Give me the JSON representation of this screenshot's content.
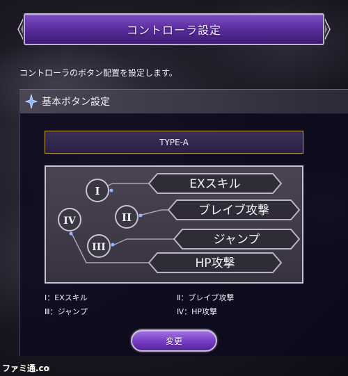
{
  "header": {
    "title": "コントローラ設定"
  },
  "description": "コントローラのボタン配置を設定します。",
  "section": {
    "title": "基本ボタン設定"
  },
  "layout_type": "TYPE-A",
  "diagram": {
    "buttons": [
      {
        "numeral": "I",
        "action": "EXスキル"
      },
      {
        "numeral": "II",
        "action": "ブレイブ攻撃"
      },
      {
        "numeral": "III",
        "action": "ジャンプ"
      },
      {
        "numeral": "IV",
        "action": "HP攻撃"
      }
    ]
  },
  "legend": {
    "i": "Ⅰ：EXスキル",
    "ii": "Ⅱ：ブレイブ攻撃",
    "iii": "Ⅲ：ジャンプ",
    "iv": "Ⅳ：HP攻撃"
  },
  "change_button": "変更",
  "watermark": "ファミ通.com",
  "colors": {
    "accent_purple": "#6a35b5",
    "gold_border": "#c9a24d",
    "panel_bg": "#0e0a1e"
  }
}
